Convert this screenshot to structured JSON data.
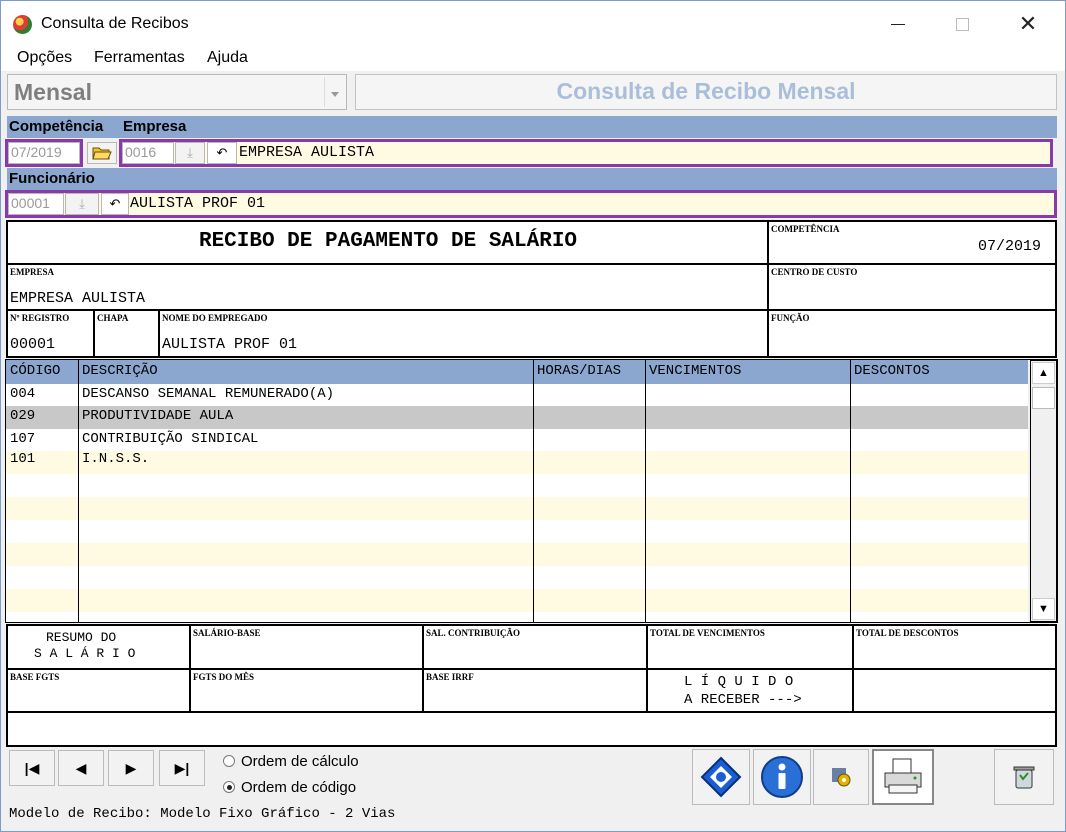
{
  "window": {
    "title": "Consulta de Recibos",
    "icon": "app-icon",
    "controls": {
      "minimize": "minimize",
      "maximize": "maximize",
      "close": "close"
    }
  },
  "menu": [
    "Opções",
    "Ferramentas",
    "Ajuda"
  ],
  "toolbar": {
    "period_select": "Mensal",
    "banner_title": "Consulta de Recibo Mensal"
  },
  "filters": {
    "competencia_label": "Competência",
    "competencia_value": "07/2019",
    "empresa_label": "Empresa",
    "empresa_code": "0016",
    "empresa_name": "EMPRESA AULISTA",
    "funcionario_label": "Funcionário",
    "funcionario_code": "00001",
    "funcionario_name": "AULISTA PROF 01"
  },
  "receipt": {
    "title": "RECIBO DE PAGAMENTO DE SALÁRIO",
    "competencia_label": "COMPETÊNCIA",
    "competencia_value": "07/2019",
    "empresa_label": "EMPRESA",
    "empresa_value": "EMPRESA AULISTA",
    "centro_custo_label": "CENTRO DE CUSTO",
    "registro_label": "Nº REGISTRO",
    "registro_value": "00001",
    "chapa_label": "CHAPA",
    "nome_label": "NOME DO EMPREGADO",
    "nome_value": "AULISTA PROF 01",
    "funcao_label": "FUNÇÃO"
  },
  "grid": {
    "columns": [
      "CÓDIGO",
      "DESCRIÇÃO",
      "HORAS/DIAS",
      "VENCIMENTOS",
      "DESCONTOS"
    ],
    "rows": [
      {
        "codigo": "004",
        "descricao": "DESCANSO SEMANAL REMUNERADO(A)",
        "horas": "",
        "vencimentos": "",
        "descontos": ""
      },
      {
        "codigo": "029",
        "descricao": "PRODUTIVIDADE AULA",
        "horas": "",
        "vencimentos": "",
        "descontos": ""
      },
      {
        "codigo": "107",
        "descricao": "CONTRIBUIÇÃO SINDICAL",
        "horas": "",
        "vencimentos": "",
        "descontos": ""
      },
      {
        "codigo": "101",
        "descricao": "I.N.S.S.",
        "horas": "",
        "vencimentos": "",
        "descontos": ""
      }
    ],
    "selected_row": 1
  },
  "summary": {
    "resumo_line1": "RESUMO DO",
    "resumo_line2": "S A L Á R I O",
    "salario_base_label": "SALÁRIO-BASE",
    "sal_contribuicao_label": "SAL. CONTRIBUIÇÃO",
    "total_vencimentos_label": "TOTAL DE VENCIMENTOS",
    "total_descontos_label": "TOTAL DE DESCONTOS",
    "base_fgts_label": "BASE FGTS",
    "fgts_mes_label": "FGTS DO MÊS",
    "base_irrf_label": "BASE IRRF",
    "liquido_line1": "L Í Q U I D O",
    "liquido_line2": "A RECEBER --->"
  },
  "sort": {
    "option_calc": "Ordem de cálculo",
    "option_code": "Ordem de código",
    "selected": "Ordem de código"
  },
  "status": "Modelo de Recibo: Modelo Fixo Gráfico - 2 Vias"
}
